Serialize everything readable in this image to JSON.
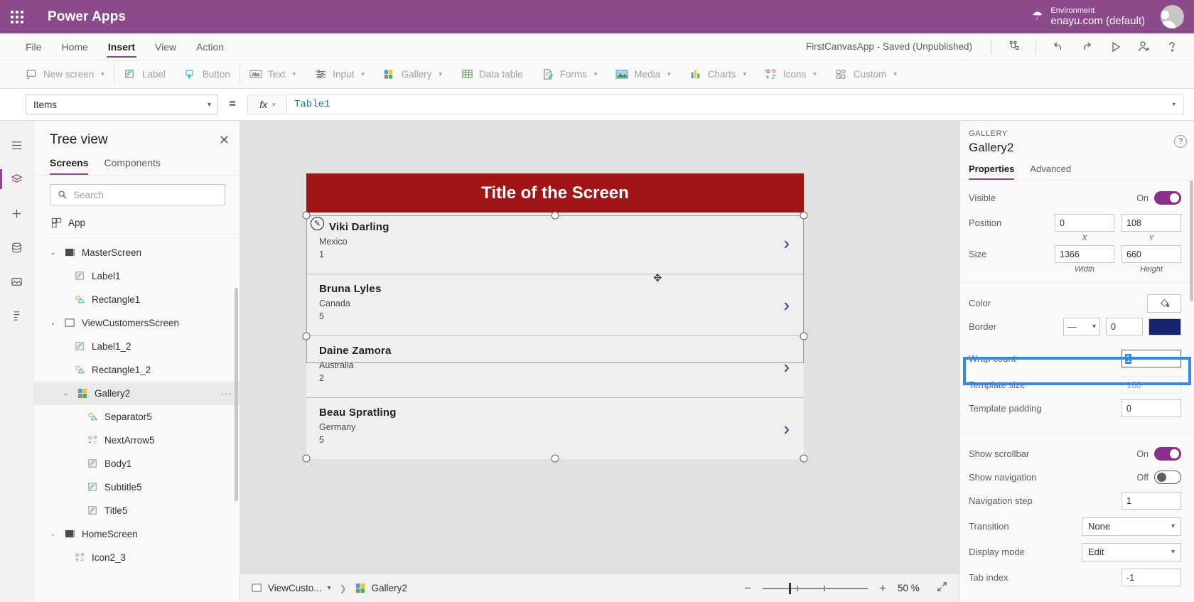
{
  "topbar": {
    "waffle_name": "app-launcher",
    "brand": "Power Apps",
    "environment_label": "Environment",
    "environment_value": "enayu.com (default)"
  },
  "menubar": {
    "items": [
      {
        "label": "File",
        "active": false
      },
      {
        "label": "Home",
        "active": false
      },
      {
        "label": "Insert",
        "active": true
      },
      {
        "label": "View",
        "active": false
      },
      {
        "label": "Action",
        "active": false
      }
    ],
    "app_status": "FirstCanvasApp - Saved (Unpublished)",
    "icons": [
      "checker-icon",
      "undo-icon",
      "redo-icon",
      "play-icon",
      "share-user-icon",
      "help-icon"
    ]
  },
  "ribbon": {
    "items": [
      {
        "label": "New screen",
        "icon": "new-screen-icon",
        "caret": true
      },
      {
        "label": "Label",
        "icon": "label-icon",
        "caret": false
      },
      {
        "label": "Button",
        "icon": "button-icon",
        "caret": false
      },
      {
        "label": "Text",
        "icon": "text-icon",
        "caret": true
      },
      {
        "label": "Input",
        "icon": "input-icon",
        "caret": true
      },
      {
        "label": "Gallery",
        "icon": "gallery-icon",
        "caret": true
      },
      {
        "label": "Data table",
        "icon": "data-table-icon",
        "caret": false
      },
      {
        "label": "Forms",
        "icon": "forms-icon",
        "caret": true
      },
      {
        "label": "Media",
        "icon": "media-icon",
        "caret": true
      },
      {
        "label": "Charts",
        "icon": "charts-icon",
        "caret": true
      },
      {
        "label": "Icons",
        "icon": "icons-icon",
        "caret": true
      },
      {
        "label": "Custom",
        "icon": "custom-icon",
        "caret": true
      }
    ]
  },
  "formulabar": {
    "property": "Items",
    "equals": "=",
    "fx": "fx",
    "formula": "Table1"
  },
  "treeview": {
    "title": "Tree view",
    "close": "✕",
    "tabs": [
      {
        "label": "Screens",
        "active": true
      },
      {
        "label": "Components",
        "active": false
      }
    ],
    "search_placeholder": "Search",
    "app_label": "App",
    "nodes": [
      {
        "label": "MasterScreen",
        "indent": 0,
        "icon": "screen-dark-icon",
        "chev": "⌄",
        "selected": false
      },
      {
        "label": "Label1",
        "indent": 1,
        "icon": "label-icon",
        "chev": "",
        "selected": false
      },
      {
        "label": "Rectangle1",
        "indent": 1,
        "icon": "shape-icon",
        "chev": "",
        "selected": false
      },
      {
        "label": "ViewCustomersScreen",
        "indent": 0,
        "icon": "screen-light-icon",
        "chev": "⌄",
        "selected": false
      },
      {
        "label": "Label1_2",
        "indent": 1,
        "icon": "label-icon",
        "chev": "",
        "selected": false
      },
      {
        "label": "Rectangle1_2",
        "indent": 1,
        "icon": "shape-icon",
        "chev": "",
        "selected": false
      },
      {
        "label": "Gallery2",
        "indent": 1,
        "icon": "gallery-icon",
        "chev": "⌄",
        "selected": true,
        "dots": "···"
      },
      {
        "label": "Separator5",
        "indent": 2,
        "icon": "shape-icon",
        "chev": "",
        "selected": false
      },
      {
        "label": "NextArrow5",
        "indent": 2,
        "icon": "icons-icon",
        "chev": "",
        "selected": false
      },
      {
        "label": "Body1",
        "indent": 2,
        "icon": "label-icon",
        "chev": "",
        "selected": false
      },
      {
        "label": "Subtitle5",
        "indent": 2,
        "icon": "label-icon",
        "chev": "",
        "selected": false
      },
      {
        "label": "Title5",
        "indent": 2,
        "icon": "label-icon",
        "chev": "",
        "selected": false
      },
      {
        "label": "HomeScreen",
        "indent": 0,
        "icon": "screen-dark-icon",
        "chev": "⌄",
        "selected": false
      },
      {
        "label": "Icon2_3",
        "indent": 1,
        "icon": "icons-icon",
        "chev": "",
        "selected": false
      }
    ]
  },
  "canvas": {
    "screen_title": "Title of the Screen",
    "title_bg": "#a31515",
    "gallery_items": [
      {
        "name": "Viki  Darling",
        "country": "Mexico",
        "number": "1"
      },
      {
        "name": "Bruna  Lyles",
        "country": "Canada",
        "number": "5"
      },
      {
        "name": "Daine  Zamora",
        "country": "Australia",
        "number": "2"
      },
      {
        "name": "Beau  Spratling",
        "country": "Germany",
        "number": "5"
      }
    ],
    "arrow_glyph": "›",
    "arrow_color": "#2b3a8c"
  },
  "statusbar": {
    "screen_chip": "ViewCusto...",
    "control_chip": "Gallery2",
    "zoom_out": "−",
    "zoom_in": "+",
    "zoom_value": "50",
    "zoom_unit": "%",
    "fit_icon": "fit-screen-icon"
  },
  "properties": {
    "kind": "GALLERY",
    "name": "Gallery2",
    "help": "?",
    "tabs": [
      {
        "label": "Properties",
        "active": true
      },
      {
        "label": "Advanced",
        "active": false
      }
    ],
    "visible": {
      "label": "Visible",
      "state": "On"
    },
    "position": {
      "label": "Position",
      "x": "0",
      "y": "108",
      "x_label": "X",
      "y_label": "Y"
    },
    "size": {
      "label": "Size",
      "width": "1366",
      "height": "660",
      "width_label": "Width",
      "height_label": "Height"
    },
    "color": {
      "label": "Color",
      "icon": "paint-bucket-icon"
    },
    "border": {
      "label": "Border",
      "style": "—",
      "thickness": "0",
      "swatch": "#12256e"
    },
    "wrap_count": {
      "label": "Wrap count",
      "value": "1",
      "highlighted": true
    },
    "template_size": {
      "label": "Template size",
      "value": "168"
    },
    "template_padding": {
      "label": "Template padding",
      "value": "0"
    },
    "show_scrollbar": {
      "label": "Show scrollbar",
      "state": "On"
    },
    "show_navigation": {
      "label": "Show navigation",
      "state": "Off"
    },
    "navigation_step": {
      "label": "Navigation step",
      "value": "1"
    },
    "transition": {
      "label": "Transition",
      "value": "None"
    },
    "display_mode": {
      "label": "Display mode",
      "value": "Edit"
    },
    "tab_index": {
      "label": "Tab index",
      "value": "-1"
    }
  }
}
